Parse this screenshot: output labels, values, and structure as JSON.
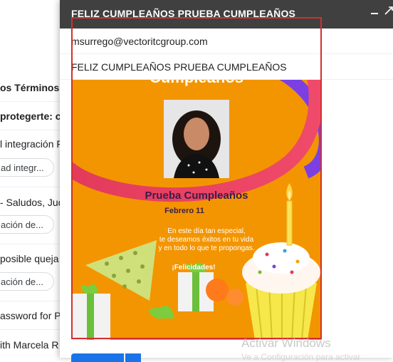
{
  "inbox": {
    "rows": [
      {
        "text": "os Términos",
        "bold": true
      },
      {
        "text": "protegerte: co",
        "bold": true
      },
      {
        "text": "l integración F",
        "bold": false
      },
      {
        "text": "- Saludos, Jud",
        "bold": false
      },
      {
        "text": "posible queja",
        "bold": false
      },
      {
        "text": "assword for P",
        "bold": false
      },
      {
        "text": "ith Marcela R",
        "bold": false
      }
    ],
    "chips": [
      "ad integr...",
      "ación de...",
      "ación de..."
    ]
  },
  "compose": {
    "title": "FELIZ CUMPLEAÑOS PRUEBA CUMPLEAÑOS",
    "minimize_icon": "minimize-icon",
    "expand_icon": "expand-icon",
    "to": "msurrego@vectoritcgroup.com",
    "subject": "FELIZ CUMPLEAÑOS PRUEBA CUMPLEAÑOS",
    "card": {
      "top_text": "Cumpleaños",
      "name": "Prueba Cumpleaños",
      "date": "Febrero 11",
      "message": [
        "En este día tan especial,",
        "te deseamos éxitos en tu vida",
        "y en todo lo que te propongas."
      ],
      "congrats": "¡Felicidades!",
      "background_color": "#f39500",
      "accent_colors": [
        "#e8305f",
        "#7b3fe4"
      ]
    }
  },
  "watermark": {
    "line1": "Activar Windows",
    "line2": "Ve a Configuración para activar"
  },
  "colors": {
    "header": "#404040",
    "selection": "#d32f2f",
    "send": "#1a73e8"
  }
}
